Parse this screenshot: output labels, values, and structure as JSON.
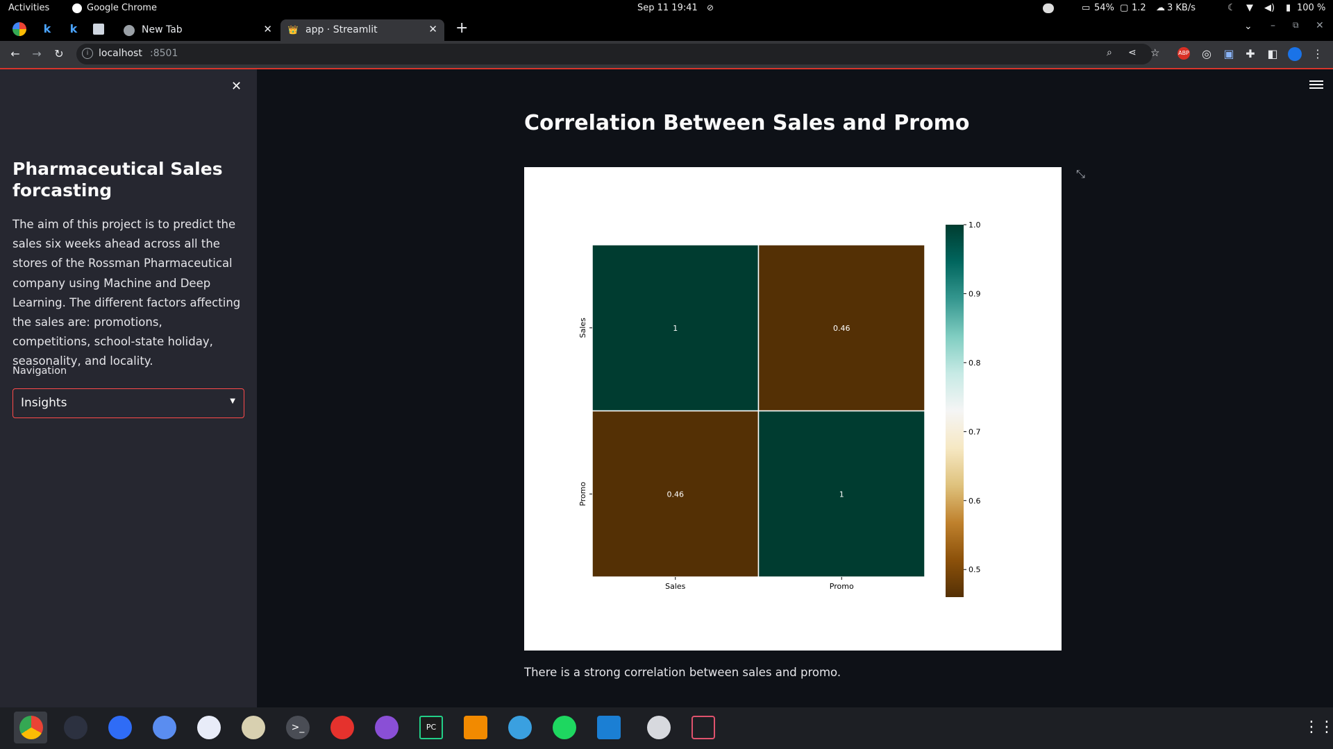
{
  "topbar": {
    "activities": "Activities",
    "app_name": "Google Chrome",
    "clock": "Sep 11  19:41",
    "battery_widget": "54%",
    "display_widget": "1.2",
    "net_speed": "3 KB/s",
    "battery": "100 %"
  },
  "browser": {
    "tabs": [
      {
        "title": "New Tab",
        "active": false
      },
      {
        "title": "app · Streamlit",
        "active": true
      }
    ],
    "new_tab_symbol": "+",
    "address": "localhost",
    "address_port": ":8501"
  },
  "sidebar": {
    "close_symbol": "✕",
    "title": "Pharmaceutical Sales forcasting",
    "description": "The aim of this project is to predict the sales six weeks ahead across all the stores of the Rossman Pharmaceutical company using Machine and Deep Learning. The different factors affecting the sales are: promotions, competitions, school-state holiday, seasonality, and locality.",
    "nav_label": "Navigation",
    "nav_selected": "Insights"
  },
  "main": {
    "heading": "Correlation Between Sales and Promo",
    "caption": "There is a strong correlation between sales and promo."
  },
  "chart_data": {
    "type": "heatmap",
    "categories_x": [
      "Sales",
      "Promo"
    ],
    "categories_y": [
      "Sales",
      "Promo"
    ],
    "values": [
      [
        1,
        0.46
      ],
      [
        0.46,
        1
      ]
    ],
    "annotations": [
      [
        "1",
        "0.46"
      ],
      [
        "0.46",
        "1"
      ]
    ],
    "colormap": "BrBG",
    "colorbar": {
      "ticks": [
        "1.0",
        "0.9",
        "0.8",
        "0.7",
        "0.6",
        "0.5"
      ],
      "tick_values": [
        1.0,
        0.9,
        0.8,
        0.7,
        0.6,
        0.5
      ],
      "range": [
        0.46,
        1.0
      ]
    },
    "colors": {
      "high": "#003c30",
      "low": "#543005"
    }
  },
  "colors": {
    "accent": "#ff4b4b",
    "sidebar_bg": "#262730",
    "main_bg": "#0e1117"
  }
}
